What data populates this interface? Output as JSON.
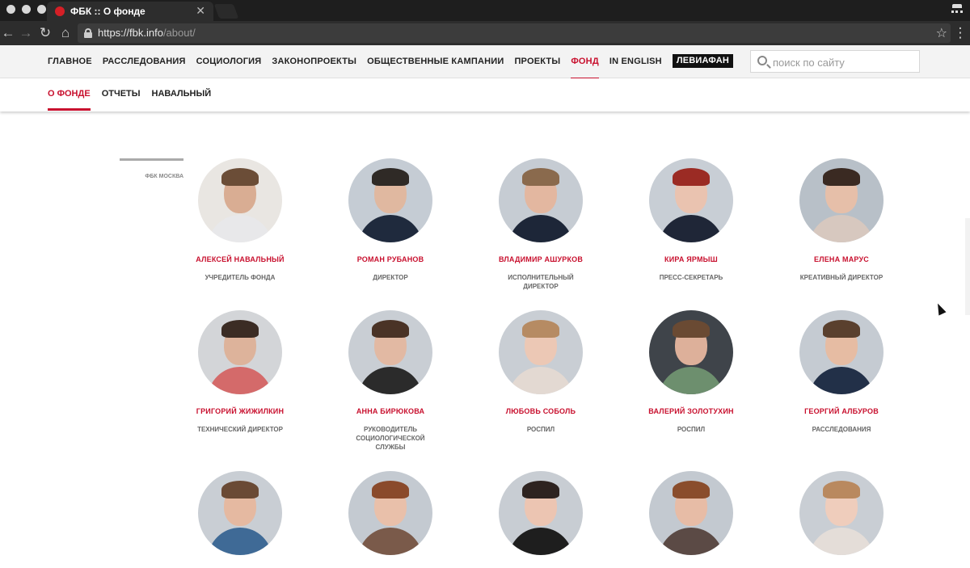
{
  "browser": {
    "tab_title": "ФБК :: О фонде",
    "tab_close": "✕",
    "url_main": "https://fbk.info",
    "url_path": "/about/",
    "back_glyph": "←",
    "forward_glyph": "→",
    "reload_glyph": "↻",
    "home_glyph": "⌂",
    "star_glyph": "☆",
    "menu_glyph": "⋮"
  },
  "nav": {
    "items": [
      {
        "label": "ГЛАВНОЕ"
      },
      {
        "label": "РАССЛЕДОВАНИЯ"
      },
      {
        "label": "СОЦИОЛОГИЯ"
      },
      {
        "label": "ЗАКОНОПРОЕКТЫ"
      },
      {
        "label": "ОБЩЕСТВЕННЫЕ КАМПАНИИ"
      },
      {
        "label": "ПРОЕКТЫ"
      },
      {
        "label": "ФОНД",
        "active": true
      },
      {
        "label": "IN ENGLISH"
      },
      {
        "label": "ЛЕВИАФАН",
        "badge": true
      }
    ],
    "search_placeholder": "поиск по сайту"
  },
  "subnav": {
    "items": [
      {
        "label": "О ФОНДЕ",
        "active": true
      },
      {
        "label": "ОТЧЕТЫ"
      },
      {
        "label": "НАВАЛЬНЫЙ"
      }
    ]
  },
  "section": {
    "label": "ФБК МОСКВА"
  },
  "team": [
    {
      "name": "АЛЕКСЕЙ НАВАЛЬНЫЙ",
      "role": "УЧРЕДИТЕЛЬ ФОНДА",
      "bg": "#e9e6e2",
      "skin": "#d9ad93",
      "hair": "#6b4d37",
      "body": "#e8e8ea"
    },
    {
      "name": "РОМАН РУБАНОВ",
      "role": "ДИРЕКТОР",
      "bg": "#c5ccd4",
      "skin": "#e0b8a0",
      "hair": "#2f2a26",
      "body": "#1f2a3d"
    },
    {
      "name": "ВЛАДИМИР АШУРКОВ",
      "role": "ИСПОЛНИТЕЛЬНЫЙ ДИРЕКТОР",
      "bg": "#c6ccd3",
      "skin": "#e3b7a0",
      "hair": "#8a6a4d",
      "body": "#1d2638"
    },
    {
      "name": "КИРА ЯРМЫШ",
      "role": "ПРЕСС-СЕКРЕТАРЬ",
      "bg": "#c8ced5",
      "skin": "#eac3b0",
      "hair": "#9b2b24",
      "body": "#1f2637"
    },
    {
      "name": "ЕЛЕНА МАРУС",
      "role": "КРЕАТИВНЫЙ ДИРЕКТОР",
      "bg": "#b8c0c8",
      "skin": "#e6bfa9",
      "hair": "#3a2a22",
      "body": "#d7c8bf"
    },
    {
      "name": "ГРИГОРИЙ ЖИЖИЛКИН",
      "role": "ТЕХНИЧЕСКИЙ ДИРЕКТОР",
      "bg": "#d3d5d8",
      "skin": "#ddb39b",
      "hair": "#3b2c24",
      "body": "#d46a6a"
    },
    {
      "name": "АННА БИРЮКОВА",
      "role": "РУКОВОДИТЕЛЬ СОЦИОЛОГИЧЕСКОЙ СЛУЖБЫ",
      "bg": "#c9ced4",
      "skin": "#e2b9a3",
      "hair": "#4a3326",
      "body": "#2b2b2b"
    },
    {
      "name": "ЛЮБОВЬ СОБОЛЬ",
      "role": "РОСПИЛ",
      "bg": "#c9ced4",
      "skin": "#ecc8b5",
      "hair": "#b68b63",
      "body": "#e3d9d2"
    },
    {
      "name": "ВАЛЕРИЙ ЗОЛОТУХИН",
      "role": "РОСПИЛ",
      "bg": "#3f444a",
      "skin": "#ddb09a",
      "hair": "#6a4a33",
      "body": "#6d8f6e"
    },
    {
      "name": "ГЕОРГИЙ АЛБУРОВ",
      "role": "РАССЛЕДОВАНИЯ",
      "bg": "#c5cbd2",
      "skin": "#e6bca3",
      "hair": "#5a402e",
      "body": "#223048"
    },
    {
      "name": "",
      "role": "",
      "bg": "#c9ced4",
      "skin": "#e5b9a1",
      "hair": "#6a4a35",
      "body": "#3f6a96"
    },
    {
      "name": "",
      "role": "",
      "bg": "#c4cad1",
      "skin": "#e9c0aa",
      "hair": "#8a4a2b",
      "body": "#7a5a4a"
    },
    {
      "name": "",
      "role": "",
      "bg": "#c8cdd3",
      "skin": "#ecc5b2",
      "hair": "#2e2320",
      "body": "#1e1e1e"
    },
    {
      "name": "",
      "role": "",
      "bg": "#c3c9d0",
      "skin": "#e7bca6",
      "hair": "#8a4d2c",
      "body": "#5b4a45"
    },
    {
      "name": "",
      "role": "",
      "bg": "#c9ced4",
      "skin": "#efcdbc",
      "hair": "#b9895f",
      "body": "#e4ddd8"
    }
  ]
}
